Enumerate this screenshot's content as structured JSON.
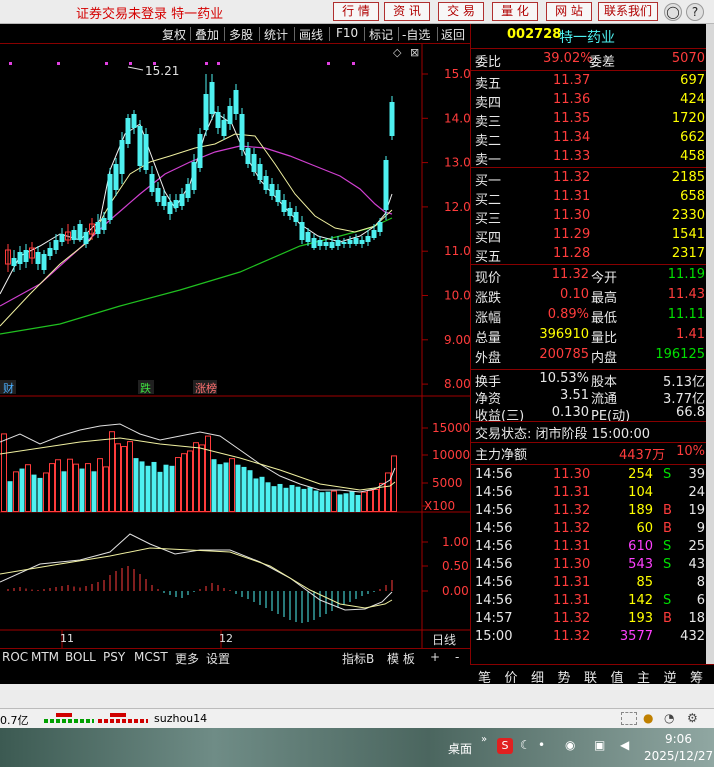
{
  "titlebar": {
    "title": "证券交易未登录  特一药业",
    "buttons": [
      "行 情",
      "资 讯",
      "交 易",
      "量 化",
      "网 站",
      "联系我们"
    ],
    "window_controls": [
      "◯",
      "?"
    ]
  },
  "toolbar": {
    "items": [
      "复权",
      "叠加",
      "多股",
      "统计",
      "画线",
      "F10",
      "标记",
      "-自选",
      "返回"
    ]
  },
  "chart": {
    "price_axis": [
      "15.00",
      "14.00",
      "13.00",
      "12.00",
      "11.00",
      "10.00",
      "9.00",
      "8.00"
    ],
    "high_label": "15.21",
    "events": [
      "财",
      "跌",
      "涨榜"
    ],
    "volume_axis": [
      "15000",
      "10000",
      "5000",
      "X100"
    ],
    "macd_axis": [
      "1.00",
      "0.50",
      "0.00"
    ],
    "month_labels": [
      "11",
      "12"
    ],
    "period_label": "日线"
  },
  "bottomtabs": [
    "ROC",
    "MTM",
    "BOLL",
    "PSY",
    "MCST",
    "更多",
    "设置",
    "指标B",
    "模 板",
    "+",
    "-"
  ],
  "panel": {
    "code": "002728",
    "name": "特一药业",
    "weibi_label": "委比",
    "weibi_value": "39.02%",
    "weicha_label": "委差",
    "weicha_value": "5070",
    "asks": [
      {
        "label": "卖五",
        "price": "11.37",
        "vol": "697"
      },
      {
        "label": "卖四",
        "price": "11.36",
        "vol": "424"
      },
      {
        "label": "卖三",
        "price": "11.35",
        "vol": "1720"
      },
      {
        "label": "卖二",
        "price": "11.34",
        "vol": "662"
      },
      {
        "label": "卖一",
        "price": "11.33",
        "vol": "458"
      }
    ],
    "bids": [
      {
        "label": "买一",
        "price": "11.32",
        "vol": "2185"
      },
      {
        "label": "买二",
        "price": "11.31",
        "vol": "658"
      },
      {
        "label": "买三",
        "price": "11.30",
        "vol": "2330"
      },
      {
        "label": "买四",
        "price": "11.29",
        "vol": "1541"
      },
      {
        "label": "买五",
        "price": "11.28",
        "vol": "2317"
      }
    ],
    "stats": [
      {
        "l1": "现价",
        "v1": "11.32",
        "c1": "red",
        "l2": "今开",
        "v2": "11.19",
        "c2": "green"
      },
      {
        "l1": "涨跌",
        "v1": "0.10",
        "c1": "red",
        "l2": "最高",
        "v2": "11.43",
        "c2": "red"
      },
      {
        "l1": "涨幅",
        "v1": "0.89%",
        "c1": "red",
        "l2": "最低",
        "v2": "11.11",
        "c2": "green"
      },
      {
        "l1": "总量",
        "v1": "396910",
        "c1": "yellow",
        "l2": "量比",
        "v2": "1.41",
        "c2": "red"
      },
      {
        "l1": "外盘",
        "v1": "200785",
        "c1": "red",
        "l2": "内盘",
        "v2": "196125",
        "c2": "green"
      }
    ],
    "stats2": [
      {
        "l1": "换手",
        "v1": "10.53%",
        "l2": "股本",
        "v2": "5.13亿"
      },
      {
        "l1": "净资",
        "v1": "3.51",
        "l2": "流通",
        "v2": "3.77亿"
      },
      {
        "l1": "收益(三)",
        "v1": "0.130",
        "l2": "PE(动)",
        "v2": "66.8"
      }
    ],
    "trade_status": "交易状态: 闭市阶段 15:00:00",
    "main_flow_label": "主力净额",
    "main_flow_value": "4437万",
    "main_flow_pct": "10%",
    "ticks": [
      {
        "t": "14:56",
        "p": "11.30",
        "v": "254",
        "s": "S",
        "n": "39",
        "vc": "yellow"
      },
      {
        "t": "14:56",
        "p": "11.31",
        "v": "104",
        "s": "",
        "n": "24",
        "vc": "yellow"
      },
      {
        "t": "14:56",
        "p": "11.32",
        "v": "189",
        "s": "B",
        "n": "19",
        "vc": "yellow"
      },
      {
        "t": "14:56",
        "p": "11.32",
        "v": "60",
        "s": "B",
        "n": "9",
        "vc": "yellow"
      },
      {
        "t": "14:56",
        "p": "11.31",
        "v": "610",
        "s": "S",
        "n": "25",
        "vc": "magenta"
      },
      {
        "t": "14:56",
        "p": "11.30",
        "v": "543",
        "s": "S",
        "n": "43",
        "vc": "magenta"
      },
      {
        "t": "14:56",
        "p": "11.31",
        "v": "85",
        "s": "",
        "n": "8",
        "vc": "yellow"
      },
      {
        "t": "14:56",
        "p": "11.31",
        "v": "142",
        "s": "S",
        "n": "6",
        "vc": "yellow"
      },
      {
        "t": "14:57",
        "p": "11.32",
        "v": "193",
        "s": "B",
        "n": "18",
        "vc": "yellow"
      },
      {
        "t": "15:00",
        "p": "11.32",
        "v": "3577",
        "s": "",
        "n": "432",
        "vc": "magenta"
      }
    ]
  },
  "panel_tabs": [
    "笔",
    "价",
    "细",
    "势",
    "联",
    "值",
    "主",
    "逆",
    "筹"
  ],
  "status": {
    "left_value": "0.7亿",
    "user": "suzhou14"
  },
  "taskbar": {
    "desktop_label": "桌面",
    "time": "9:06",
    "date": "2025/12/27"
  }
}
